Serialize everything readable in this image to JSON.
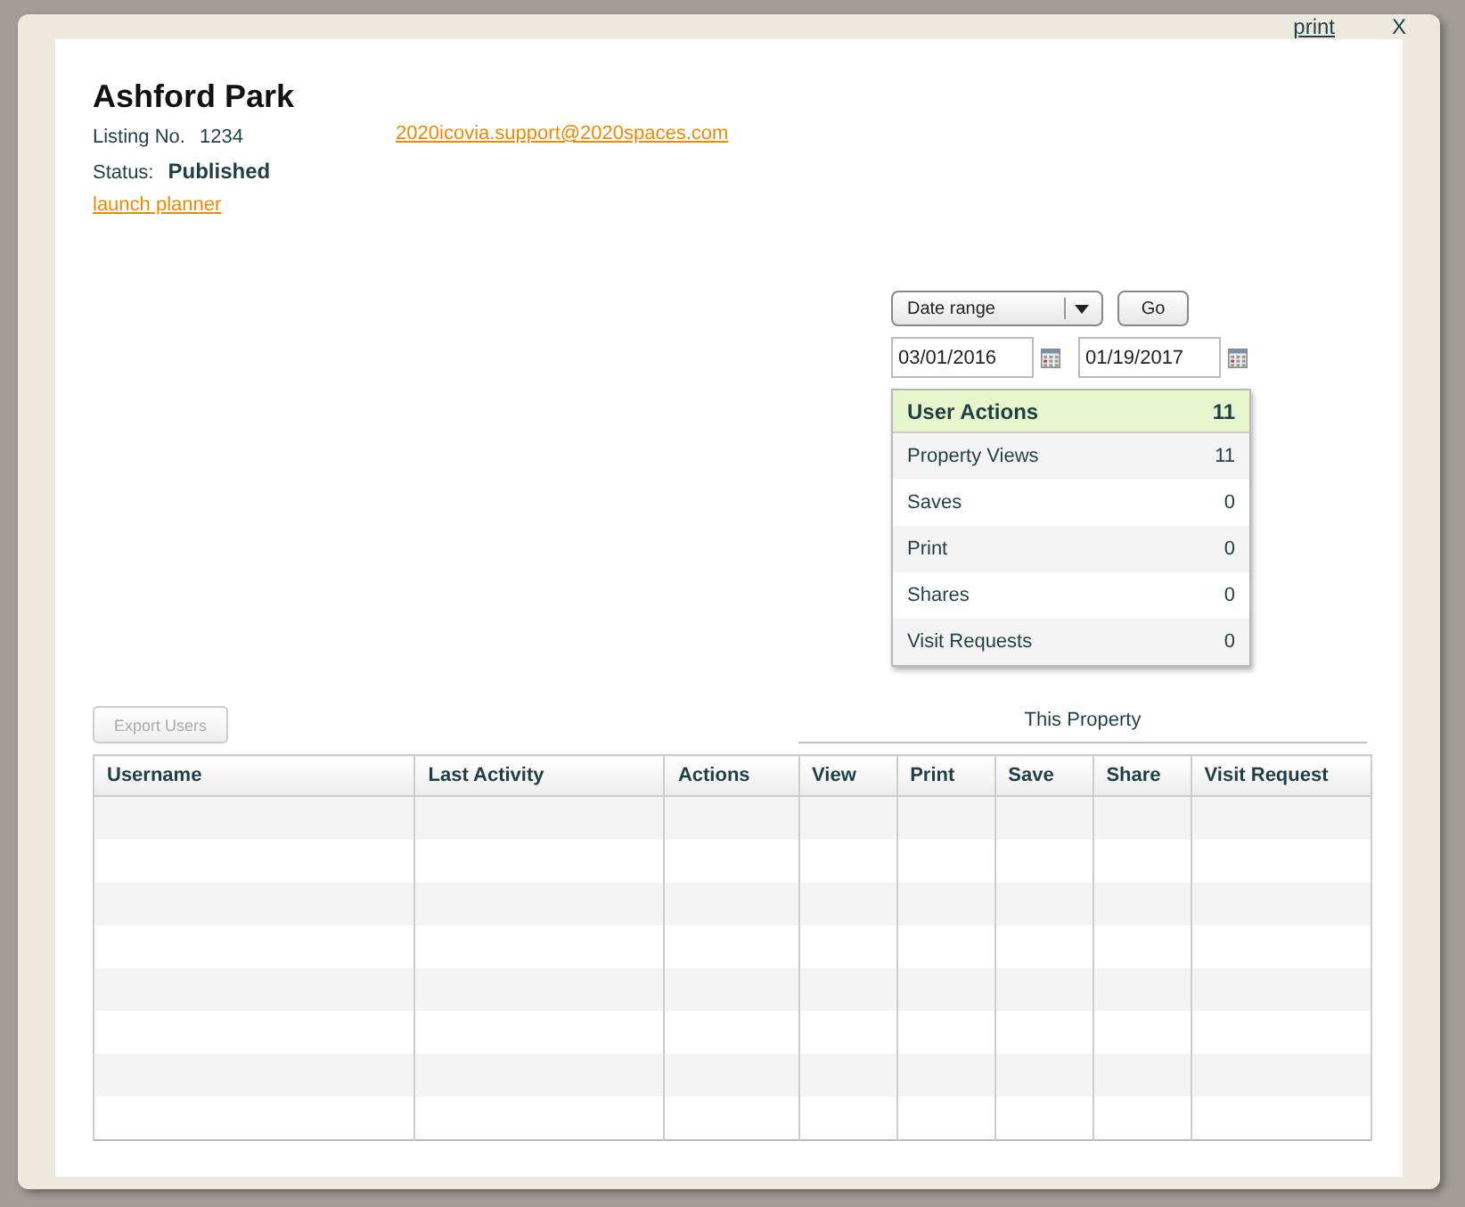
{
  "dialog": {
    "print_link": "print",
    "close": "X"
  },
  "property": {
    "name": "Ashford Park",
    "listing_label": "Listing No.",
    "listing_no": "1234",
    "status_label": "Status:",
    "status": "Published",
    "planner_link": "launch planner",
    "support_email": "2020icovia.support@2020spaces.com"
  },
  "filter": {
    "range_select": "Date range",
    "go_button": "Go",
    "start_date": "03/01/2016",
    "end_date": "01/19/2017"
  },
  "user_actions": {
    "title": "User Actions",
    "total": "11",
    "rows": [
      {
        "label": "Property Views",
        "value": "11"
      },
      {
        "label": "Saves",
        "value": "0"
      },
      {
        "label": "Print",
        "value": "0"
      },
      {
        "label": "Shares",
        "value": "0"
      },
      {
        "label": "Visit Requests",
        "value": "0"
      }
    ]
  },
  "export_button": {
    "label": "Export Users",
    "disabled": true
  },
  "group_heading": "This Property",
  "table": {
    "columns": [
      "Username",
      "Last Activity",
      "Actions",
      "View",
      "Print",
      "Save",
      "Share",
      "Visit Request"
    ]
  }
}
